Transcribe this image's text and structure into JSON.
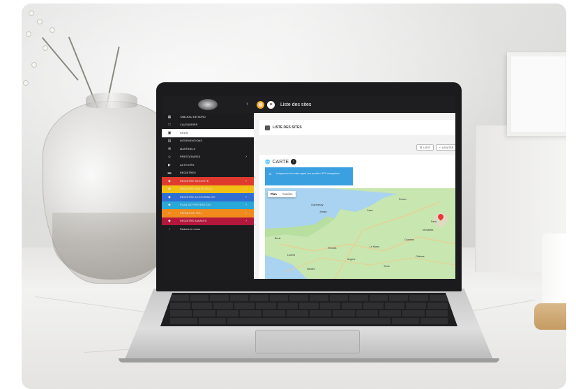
{
  "scene": {
    "description_tags": [
      "laptop",
      "glass-vase",
      "marble-table"
    ]
  },
  "app": {
    "topbar": {
      "title": "Liste des sites",
      "btn1_icon": "grid-icon",
      "btn2_icon": "menu-icon"
    },
    "sidebar": {
      "items": [
        {
          "label": "TABLEAU DE BORD",
          "icon": "dashboard-icon"
        },
        {
          "label": "CALENDRIER",
          "icon": "calendar-icon"
        },
        {
          "label": "SITES",
          "icon": "building-icon",
          "active": true
        },
        {
          "label": "INTERVENTIONS",
          "icon": "clipboard-icon"
        },
        {
          "label": "MATÉRIELS",
          "icon": "tool-icon"
        },
        {
          "label": "PRESTATAIRES",
          "icon": "people-icon",
          "chevron": true
        },
        {
          "label": "ACTIVITÉS",
          "icon": "activity-icon"
        },
        {
          "label": "REGISTRES",
          "icon": "book-icon"
        },
        {
          "label": "REGISTRE SECURITE",
          "icon": "shield-icon",
          "color": "#e03a2e",
          "chevron": true
        },
        {
          "label": "REGISTRE SANTE SECU",
          "icon": "shield-icon",
          "color": "#f2c014",
          "chevron": true
        },
        {
          "label": "REGISTRE ACCESSIBILITE",
          "icon": "shield-icon",
          "color": "#2f6fd4",
          "chevron": true
        },
        {
          "label": "PLAN DE PREVENTION",
          "icon": "shield-icon",
          "color": "#2aa8d8",
          "chevron": true
        },
        {
          "label": "PERMIS DE FEU",
          "icon": "fire-icon",
          "color": "#f08a1c",
          "chevron": true
        },
        {
          "label": "REGISTRE AMIANTE",
          "icon": "shield-icon",
          "color": "#b3173b",
          "chevron": true
        },
        {
          "label": "Réduire le menu",
          "icon": "chevron-left-icon"
        }
      ]
    },
    "main": {
      "header": "LISTE DES SITES",
      "buttons": [
        {
          "label": "LISTE",
          "icon": "list-icon"
        },
        {
          "label": "AJOUTER",
          "icon": "plus-icon"
        }
      ],
      "map_card": {
        "title": "CARTE",
        "info": "Uniquement les sites ayant une position GPS enregistrée",
        "toggle": {
          "on": "Plan",
          "off": "Satellite"
        },
        "places": [
          "Guernesey",
          "Jersey",
          "Caen",
          "Rouen",
          "Paris",
          "Rennes",
          "Brest",
          "Nantes",
          "Le Mans",
          "Tours",
          "Lorient",
          "Orléans",
          "Versailles",
          "Angers",
          "Chartres"
        ]
      }
    }
  },
  "colors": {
    "sidebar_bg": "#1c1c1e",
    "topbar_bg": "#1e1e20",
    "info_box": "#3aa0e0",
    "map_pin": "#e53935"
  }
}
